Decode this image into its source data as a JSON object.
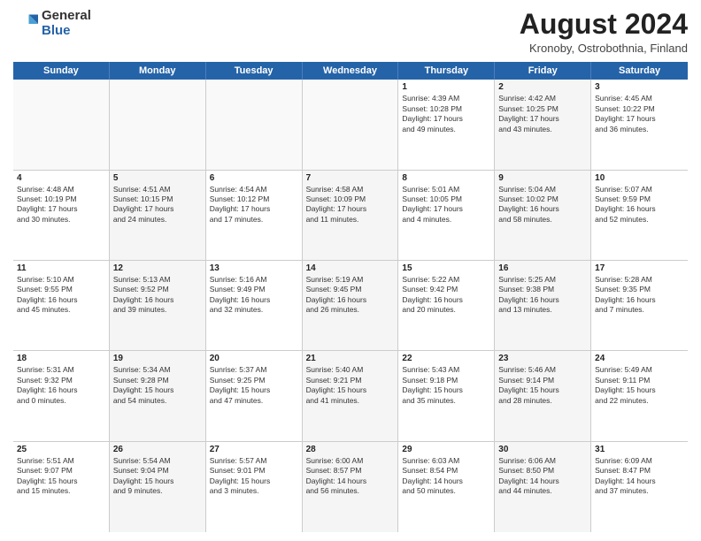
{
  "logo": {
    "general": "General",
    "blue": "Blue"
  },
  "title": "August 2024",
  "location": "Kronoby, Ostrobothnia, Finland",
  "days": [
    "Sunday",
    "Monday",
    "Tuesday",
    "Wednesday",
    "Thursday",
    "Friday",
    "Saturday"
  ],
  "weeks": [
    [
      {
        "day": "",
        "info": ""
      },
      {
        "day": "",
        "info": ""
      },
      {
        "day": "",
        "info": ""
      },
      {
        "day": "",
        "info": ""
      },
      {
        "day": "1",
        "info": "Sunrise: 4:39 AM\nSunset: 10:28 PM\nDaylight: 17 hours\nand 49 minutes."
      },
      {
        "day": "2",
        "info": "Sunrise: 4:42 AM\nSunset: 10:25 PM\nDaylight: 17 hours\nand 43 minutes."
      },
      {
        "day": "3",
        "info": "Sunrise: 4:45 AM\nSunset: 10:22 PM\nDaylight: 17 hours\nand 36 minutes."
      }
    ],
    [
      {
        "day": "4",
        "info": "Sunrise: 4:48 AM\nSunset: 10:19 PM\nDaylight: 17 hours\nand 30 minutes."
      },
      {
        "day": "5",
        "info": "Sunrise: 4:51 AM\nSunset: 10:15 PM\nDaylight: 17 hours\nand 24 minutes."
      },
      {
        "day": "6",
        "info": "Sunrise: 4:54 AM\nSunset: 10:12 PM\nDaylight: 17 hours\nand 17 minutes."
      },
      {
        "day": "7",
        "info": "Sunrise: 4:58 AM\nSunset: 10:09 PM\nDaylight: 17 hours\nand 11 minutes."
      },
      {
        "day": "8",
        "info": "Sunrise: 5:01 AM\nSunset: 10:05 PM\nDaylight: 17 hours\nand 4 minutes."
      },
      {
        "day": "9",
        "info": "Sunrise: 5:04 AM\nSunset: 10:02 PM\nDaylight: 16 hours\nand 58 minutes."
      },
      {
        "day": "10",
        "info": "Sunrise: 5:07 AM\nSunset: 9:59 PM\nDaylight: 16 hours\nand 52 minutes."
      }
    ],
    [
      {
        "day": "11",
        "info": "Sunrise: 5:10 AM\nSunset: 9:55 PM\nDaylight: 16 hours\nand 45 minutes."
      },
      {
        "day": "12",
        "info": "Sunrise: 5:13 AM\nSunset: 9:52 PM\nDaylight: 16 hours\nand 39 minutes."
      },
      {
        "day": "13",
        "info": "Sunrise: 5:16 AM\nSunset: 9:49 PM\nDaylight: 16 hours\nand 32 minutes."
      },
      {
        "day": "14",
        "info": "Sunrise: 5:19 AM\nSunset: 9:45 PM\nDaylight: 16 hours\nand 26 minutes."
      },
      {
        "day": "15",
        "info": "Sunrise: 5:22 AM\nSunset: 9:42 PM\nDaylight: 16 hours\nand 20 minutes."
      },
      {
        "day": "16",
        "info": "Sunrise: 5:25 AM\nSunset: 9:38 PM\nDaylight: 16 hours\nand 13 minutes."
      },
      {
        "day": "17",
        "info": "Sunrise: 5:28 AM\nSunset: 9:35 PM\nDaylight: 16 hours\nand 7 minutes."
      }
    ],
    [
      {
        "day": "18",
        "info": "Sunrise: 5:31 AM\nSunset: 9:32 PM\nDaylight: 16 hours\nand 0 minutes."
      },
      {
        "day": "19",
        "info": "Sunrise: 5:34 AM\nSunset: 9:28 PM\nDaylight: 15 hours\nand 54 minutes."
      },
      {
        "day": "20",
        "info": "Sunrise: 5:37 AM\nSunset: 9:25 PM\nDaylight: 15 hours\nand 47 minutes."
      },
      {
        "day": "21",
        "info": "Sunrise: 5:40 AM\nSunset: 9:21 PM\nDaylight: 15 hours\nand 41 minutes."
      },
      {
        "day": "22",
        "info": "Sunrise: 5:43 AM\nSunset: 9:18 PM\nDaylight: 15 hours\nand 35 minutes."
      },
      {
        "day": "23",
        "info": "Sunrise: 5:46 AM\nSunset: 9:14 PM\nDaylight: 15 hours\nand 28 minutes."
      },
      {
        "day": "24",
        "info": "Sunrise: 5:49 AM\nSunset: 9:11 PM\nDaylight: 15 hours\nand 22 minutes."
      }
    ],
    [
      {
        "day": "25",
        "info": "Sunrise: 5:51 AM\nSunset: 9:07 PM\nDaylight: 15 hours\nand 15 minutes."
      },
      {
        "day": "26",
        "info": "Sunrise: 5:54 AM\nSunset: 9:04 PM\nDaylight: 15 hours\nand 9 minutes."
      },
      {
        "day": "27",
        "info": "Sunrise: 5:57 AM\nSunset: 9:01 PM\nDaylight: 15 hours\nand 3 minutes."
      },
      {
        "day": "28",
        "info": "Sunrise: 6:00 AM\nSunset: 8:57 PM\nDaylight: 14 hours\nand 56 minutes."
      },
      {
        "day": "29",
        "info": "Sunrise: 6:03 AM\nSunset: 8:54 PM\nDaylight: 14 hours\nand 50 minutes."
      },
      {
        "day": "30",
        "info": "Sunrise: 6:06 AM\nSunset: 8:50 PM\nDaylight: 14 hours\nand 44 minutes."
      },
      {
        "day": "31",
        "info": "Sunrise: 6:09 AM\nSunset: 8:47 PM\nDaylight: 14 hours\nand 37 minutes."
      }
    ]
  ]
}
